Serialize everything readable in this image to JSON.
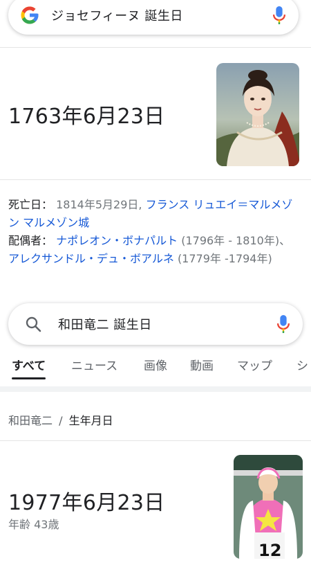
{
  "search1": {
    "query": "ジョセフィーヌ 誕生日"
  },
  "card1": {
    "birth_date": "1763年6月23日",
    "death_label": "死亡日：",
    "death_value": "1814年5月29日,",
    "death_place": "フランス リュエイ＝マルメゾン マルメゾン城",
    "spouse_label": "配偶者：",
    "spouse1_name": "ナポレオン・ボナパルト",
    "spouse1_years_a": "(1796年 - 1810",
    "spouse1_years_b": "年)、",
    "spouse2_name": "アレクサンドル・デュ・ボアルネ",
    "spouse2_years_a": "(1779年 -",
    "spouse2_years_b": "1794年)"
  },
  "search2": {
    "query": "和田竜二 誕生日"
  },
  "tabs": [
    "すべて",
    "ニュース",
    "画像",
    "動画",
    "マップ",
    "シ"
  ],
  "card2": {
    "breadcrumb_entity": "和田竜二",
    "breadcrumb_sep": "/",
    "breadcrumb_attr": "生年月日",
    "birth_date": "1977年6月23日",
    "age": "年齢 43歳",
    "jersey_number": "12"
  },
  "colors": {
    "link": "#1558d6",
    "google_blue": "#4285f4",
    "google_red": "#ea4335",
    "google_yellow": "#fbbc05",
    "google_green": "#34a853"
  }
}
